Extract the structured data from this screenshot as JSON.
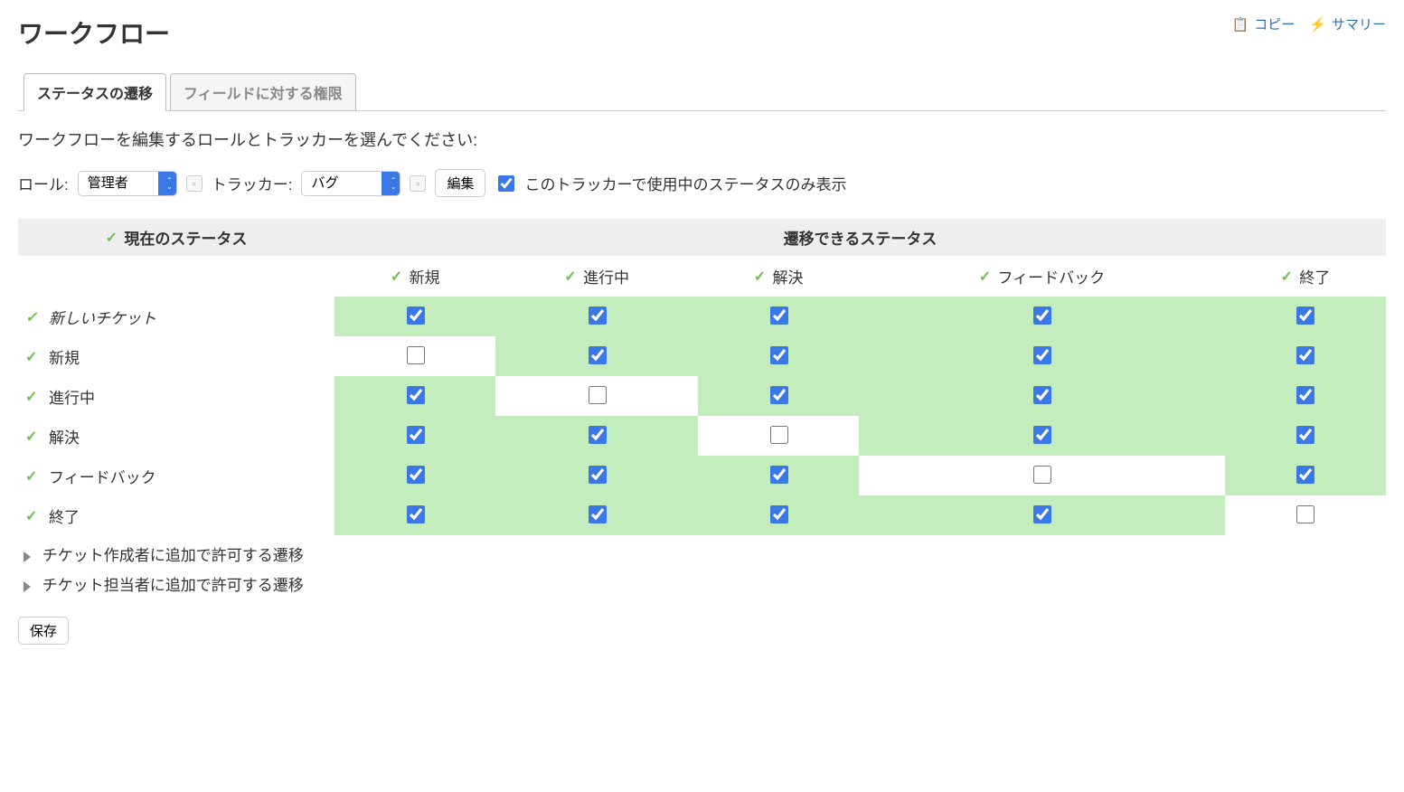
{
  "title": "ワークフロー",
  "actions": {
    "copy": "コピー",
    "summary": "サマリー"
  },
  "tabs": {
    "status_transition": "ステータスの遷移",
    "field_permission": "フィールドに対する権限"
  },
  "instruction": "ワークフローを編集するロールとトラッカーを選んでください:",
  "filters": {
    "role_label": "ロール:",
    "role_value": "管理者",
    "tracker_label": "トラッカー:",
    "tracker_value": "バグ",
    "edit_button": "編集",
    "only_used_label": "このトラッカーで使用中のステータスのみ表示",
    "only_used_checked": true
  },
  "table": {
    "head_current": "現在のステータス",
    "head_allowed": "遷移できるステータス",
    "columns": [
      "新規",
      "進行中",
      "解決",
      "フィードバック",
      "終了"
    ],
    "rows": [
      {
        "label": "新しいチケット",
        "new_ticket": true,
        "cells": [
          true,
          true,
          true,
          true,
          true
        ]
      },
      {
        "label": "新規",
        "new_ticket": false,
        "cells": [
          false,
          true,
          true,
          true,
          true
        ]
      },
      {
        "label": "進行中",
        "new_ticket": false,
        "cells": [
          true,
          false,
          true,
          true,
          true
        ]
      },
      {
        "label": "解決",
        "new_ticket": false,
        "cells": [
          true,
          true,
          false,
          true,
          true
        ]
      },
      {
        "label": "フィードバック",
        "new_ticket": false,
        "cells": [
          true,
          true,
          true,
          false,
          true
        ]
      },
      {
        "label": "終了",
        "new_ticket": false,
        "cells": [
          true,
          true,
          true,
          true,
          false
        ]
      }
    ]
  },
  "foldables": {
    "author_extra": "チケット作成者に追加で許可する遷移",
    "assignee_extra": "チケット担当者に追加で許可する遷移"
  },
  "save_button": "保存"
}
